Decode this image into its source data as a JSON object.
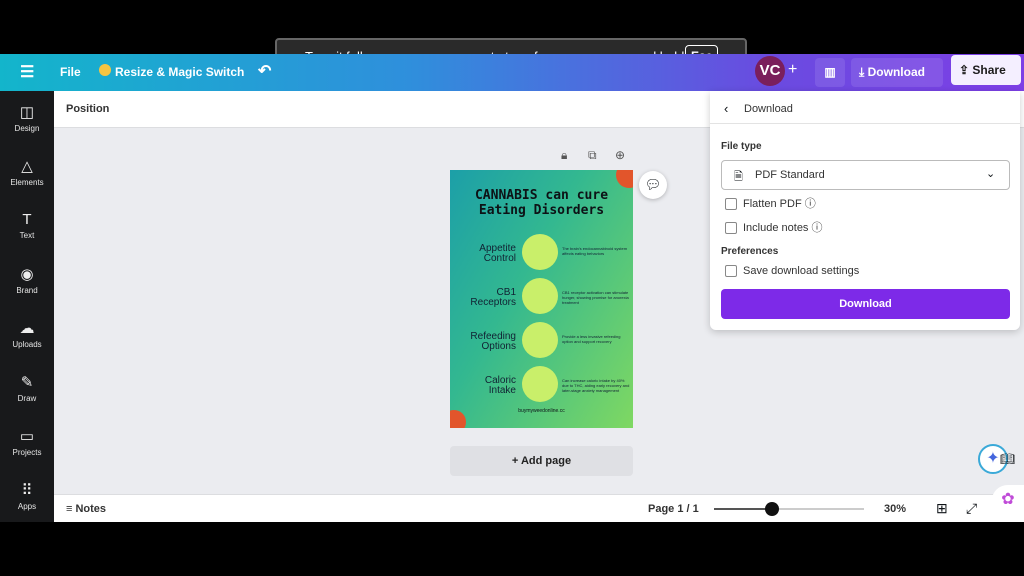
{
  "toast": {
    "text": "To exit full screen, move mouse to top of screen or press and hold",
    "key": "Esc"
  },
  "toolbar": {
    "file": "File",
    "resize": "Resize & Magic Switch",
    "avatar": "VC",
    "download": "Download",
    "share": "Share"
  },
  "sidebar": {
    "items": [
      {
        "label": "Design",
        "icon": "design-icon"
      },
      {
        "label": "Elements",
        "icon": "elements-icon"
      },
      {
        "label": "Text",
        "icon": "text-icon"
      },
      {
        "label": "Brand",
        "icon": "brand-icon"
      },
      {
        "label": "Uploads",
        "icon": "uploads-icon"
      },
      {
        "label": "Draw",
        "icon": "draw-icon"
      },
      {
        "label": "Projects",
        "icon": "projects-icon"
      },
      {
        "label": "Apps",
        "icon": "apps-icon"
      }
    ]
  },
  "position_label": "Position",
  "poster": {
    "title_line1": "CANNABIS can cure",
    "title_line2": "Eating Disorders",
    "sections": [
      {
        "label1": "Appetite",
        "label2": "Control",
        "desc": "The brain's endocannabinoid system affects eating behaviors"
      },
      {
        "label1": "CB1",
        "label2": "Receptors",
        "desc": "CB1 receptor activation can stimulate hunger, showing promise for anorexia treatment"
      },
      {
        "label1": "Refeeding",
        "label2": "Options",
        "desc": "Provide a less invasive refeeding option and support recovery"
      },
      {
        "label1": "Caloric",
        "label2": "Intake",
        "desc": "Can increase caloric intake by 40% due to THC, aiding early recovery and later-stage anxiety management"
      }
    ],
    "footer": "buymyweedonline.cc"
  },
  "add_page": "+ Add page",
  "download_panel": {
    "title": "Download",
    "file_type_label": "File type",
    "file_type_value": "PDF Standard",
    "flatten": "Flatten PDF",
    "notes": "Include notes",
    "preferences": "Preferences",
    "save_settings": "Save download settings",
    "button": "Download"
  },
  "bottom": {
    "notes": "Notes",
    "page": "Page 1 / 1",
    "zoom": "30%",
    "zoom_value": 30
  },
  "colors": {
    "accent": "#7d2ae8",
    "sidebar": "#18191b",
    "avatar": "#7a1f5c"
  }
}
